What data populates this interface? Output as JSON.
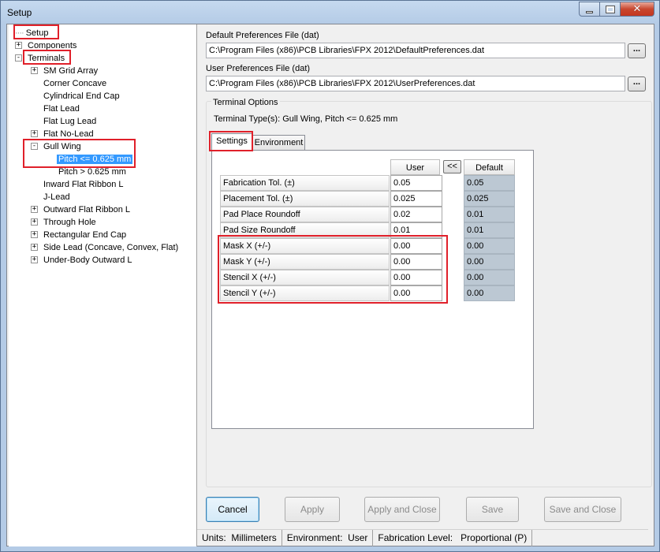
{
  "window": {
    "title": "Setup"
  },
  "tree": {
    "items": [
      {
        "label": "Setup",
        "level": 0,
        "expander": ""
      },
      {
        "label": "Components",
        "level": 0,
        "expander": "+"
      },
      {
        "label": "Terminals",
        "level": 0,
        "expander": "-"
      },
      {
        "label": "SM Grid Array",
        "level": 1,
        "expander": "+"
      },
      {
        "label": "Corner Concave",
        "level": 1,
        "expander": ""
      },
      {
        "label": "Cylindrical End Cap",
        "level": 1,
        "expander": ""
      },
      {
        "label": "Flat Lead",
        "level": 1,
        "expander": ""
      },
      {
        "label": "Flat Lug Lead",
        "level": 1,
        "expander": ""
      },
      {
        "label": "Flat No-Lead",
        "level": 1,
        "expander": "+"
      },
      {
        "label": "Gull Wing",
        "level": 1,
        "expander": "-"
      },
      {
        "label": "Pitch <= 0.625 mm",
        "level": 2,
        "expander": "",
        "selected": true
      },
      {
        "label": "Pitch > 0.625 mm",
        "level": 2,
        "expander": ""
      },
      {
        "label": "Inward Flat Ribbon L",
        "level": 1,
        "expander": ""
      },
      {
        "label": "J-Lead",
        "level": 1,
        "expander": ""
      },
      {
        "label": "Outward Flat Ribbon L",
        "level": 1,
        "expander": "+"
      },
      {
        "label": "Through Hole",
        "level": 1,
        "expander": "+"
      },
      {
        "label": "Rectangular End Cap",
        "level": 1,
        "expander": "+"
      },
      {
        "label": "Side Lead (Concave, Convex, Flat)",
        "level": 1,
        "expander": "+"
      },
      {
        "label": "Under-Body Outward L",
        "level": 1,
        "expander": "+"
      }
    ]
  },
  "prefs": {
    "default_label": "Default Preferences File  (dat)",
    "default_path": "C:\\Program Files (x86)\\PCB Libraries\\FPX 2012\\DefaultPreferences.dat",
    "user_label": "User Preferences File  (dat)",
    "user_path": "C:\\Program Files (x86)\\PCB Libraries\\FPX 2012\\UserPreferences.dat",
    "browse_label": "..."
  },
  "terminal_options": {
    "group_label": "Terminal Options",
    "type_text": "Terminal Type(s): Gull Wing, Pitch <= 0.625 mm",
    "tabs": [
      "Settings",
      "Environment"
    ],
    "col_user": "User",
    "col_default": "Default",
    "swap_label": "<<",
    "rows": [
      {
        "label": "Fabrication Tol. (±)",
        "user": "0.05",
        "default": "0.05"
      },
      {
        "label": "Placement Tol. (±)",
        "user": "0.025",
        "default": "0.025"
      },
      {
        "label": "Pad Place Roundoff",
        "user": "0.02",
        "default": "0.01"
      },
      {
        "label": "Pad Size Roundoff",
        "user": "0.01",
        "default": "0.01"
      },
      {
        "label": "Mask X (+/-)",
        "user": "0.00",
        "default": "0.00"
      },
      {
        "label": "Mask Y (+/-)",
        "user": "0.00",
        "default": "0.00"
      },
      {
        "label": "Stencil X (+/-)",
        "user": "0.00",
        "default": "0.00"
      },
      {
        "label": "Stencil Y (+/-)",
        "user": "0.00",
        "default": "0.00"
      }
    ]
  },
  "buttons": {
    "cancel": "Cancel",
    "apply": "Apply",
    "apply_close": "Apply and Close",
    "save": "Save",
    "save_close": "Save and Close"
  },
  "status": {
    "units_label": "Units:",
    "units_value": "Millimeters",
    "env_label": "Environment:",
    "env_value": "User",
    "fab_label": "Fabrication Level:",
    "fab_value": "Proportional (P)"
  }
}
